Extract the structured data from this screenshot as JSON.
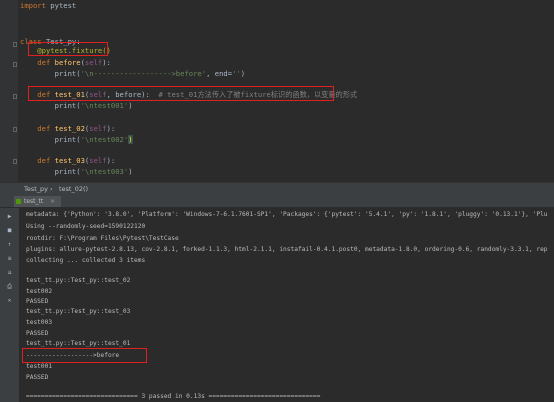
{
  "editor": {
    "lines": [
      {
        "segments": [
          {
            "t": "import ",
            "c": "kw"
          },
          {
            "t": "pytest",
            "c": ""
          }
        ]
      },
      {
        "segments": [
          {
            "t": "class ",
            "c": "kw"
          },
          {
            "t": "Test_py:",
            "c": ""
          }
        ]
      },
      {
        "segments": [
          {
            "t": "    @pytest.fixture()",
            "c": "deco"
          }
        ]
      },
      {
        "segments": [
          {
            "t": "    def ",
            "c": "kw"
          },
          {
            "t": "before",
            "c": "fn"
          },
          {
            "t": "(",
            "c": ""
          },
          {
            "t": "self",
            "c": "self"
          },
          {
            "t": "):",
            "c": ""
          }
        ]
      },
      {
        "segments": [
          {
            "t": "        print(",
            "c": ""
          },
          {
            "t": "'\\n------------------>before'",
            "c": "str"
          },
          {
            "t": ", end=",
            "c": ""
          },
          {
            "t": "''",
            "c": "str"
          },
          {
            "t": ")",
            "c": ""
          }
        ]
      },
      {
        "segments": [
          {
            "t": "    def ",
            "c": "kw"
          },
          {
            "t": "test_01",
            "c": "fn"
          },
          {
            "t": "(",
            "c": ""
          },
          {
            "t": "self",
            "c": "self"
          },
          {
            "t": ", before):  ",
            "c": ""
          },
          {
            "t": "# test_01方法传入了被fixture标识的函数，以变量的形式",
            "c": "cmt"
          }
        ]
      },
      {
        "segments": [
          {
            "t": "        print(",
            "c": ""
          },
          {
            "t": "'\\ntest001'",
            "c": "str"
          },
          {
            "t": ")",
            "c": ""
          }
        ]
      },
      {
        "segments": [
          {
            "t": "    def ",
            "c": "kw"
          },
          {
            "t": "test_02",
            "c": "fn"
          },
          {
            "t": "(",
            "c": ""
          },
          {
            "t": "self",
            "c": "self"
          },
          {
            "t": "):",
            "c": ""
          }
        ]
      },
      {
        "segments": [
          {
            "t": "        print(",
            "c": ""
          },
          {
            "t": "'\\ntest002'",
            "c": "str"
          },
          {
            "t": ")",
            "c": "hl"
          }
        ]
      },
      {
        "segments": [
          {
            "t": "    def ",
            "c": "kw"
          },
          {
            "t": "test_03",
            "c": "fn"
          },
          {
            "t": "(",
            "c": ""
          },
          {
            "t": "self",
            "c": "self"
          },
          {
            "t": "):",
            "c": ""
          }
        ]
      },
      {
        "segments": [
          {
            "t": "        print(",
            "c": ""
          },
          {
            "t": "'\\ntest003'",
            "c": "str"
          },
          {
            "t": ")",
            "c": ""
          }
        ]
      }
    ]
  },
  "breadcrumb": {
    "class_name": "Test_py",
    "separator": "›",
    "method": "test_02()"
  },
  "run_panel": {
    "tab_label": "test_tt",
    "close": "×"
  },
  "console": {
    "lines": [
      "metadata: {'Python': '3.8.0', 'Platform': 'Windows-7-6.1.7601-SP1', 'Packages': {'pytest': '5.4.1', 'py': '1.8.1', 'pluggy': '0.13.1'}, 'Plu",
      "Using --randomly-seed=1590122120",
      "rootdir: F:\\Program Files\\Pytest\\TestCase",
      "plugins: allure-pytest-2.8.13, cov-2.8.1, forked-1.1.3, html-2.1.1, instafail-0.4.1.post0, metadata-1.8.0, ordering-0.6, randomly-3.3.1, rep",
      "collecting ... collected 3 items",
      "",
      "test_tt.py::Test_py::test_02",
      "test002",
      "PASSED",
      "test_tt.py::Test_py::test_03",
      "test003",
      "PASSED",
      "test_tt.py::Test_py::test_01",
      "------------------>before",
      "test001",
      "PASSED",
      "",
      "============================== 3 passed in 0.13s =============================="
    ]
  },
  "colors": {
    "keyword": "#cc7832",
    "function": "#ffc66d",
    "string": "#6a8759",
    "comment": "#808080",
    "highlight_box": "#e02020"
  }
}
